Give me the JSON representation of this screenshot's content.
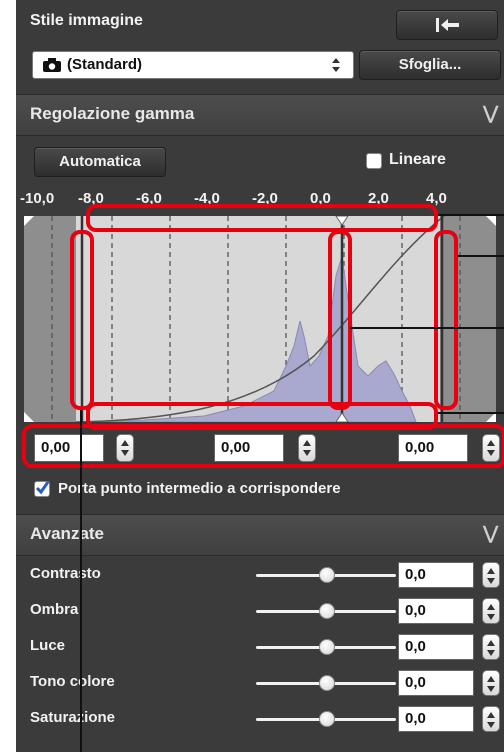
{
  "style_section": {
    "title": "Stile immagine",
    "selected_style": "(Standard)",
    "browse_label": "Sfoglia..."
  },
  "gamma_section": {
    "title": "Regolazione gamma",
    "auto_label": "Automatica",
    "linear_label": "Lineare",
    "linear_checked": false,
    "scale_labels": [
      "-10,0",
      "-8,0",
      "-6,0",
      "-4,0",
      "-2,0",
      "0,0",
      "2,0",
      "4,0"
    ],
    "inputs": {
      "left": "0,00",
      "middle": "0,00",
      "right": "0,00"
    },
    "match_midpoint_label": "Porta punto intermedio a corrispondere",
    "match_midpoint_checked": true
  },
  "advanced_section": {
    "title": "Avanzate",
    "rows": [
      {
        "label": "Contrasto",
        "value": "0,0",
        "level": 0.5
      },
      {
        "label": "Ombra",
        "value": "0,0",
        "level": 0.5
      },
      {
        "label": "Luce",
        "value": "0,0",
        "level": 0.5
      },
      {
        "label": "Tono colore",
        "value": "0,0",
        "level": 0.5
      },
      {
        "label": "Saturazione",
        "value": "0,0",
        "level": 0.5
      }
    ]
  },
  "colors": {
    "panel_bg": "#3b3b3b",
    "histogram_bg": "#d8d8d8",
    "histogram_fill": "#a9a9cf",
    "annotation_red": "#e60012"
  },
  "icons": {
    "reset": "reset-arrow-icon",
    "camera": "camera-icon",
    "chevron": "double-chevron-down-icon"
  }
}
